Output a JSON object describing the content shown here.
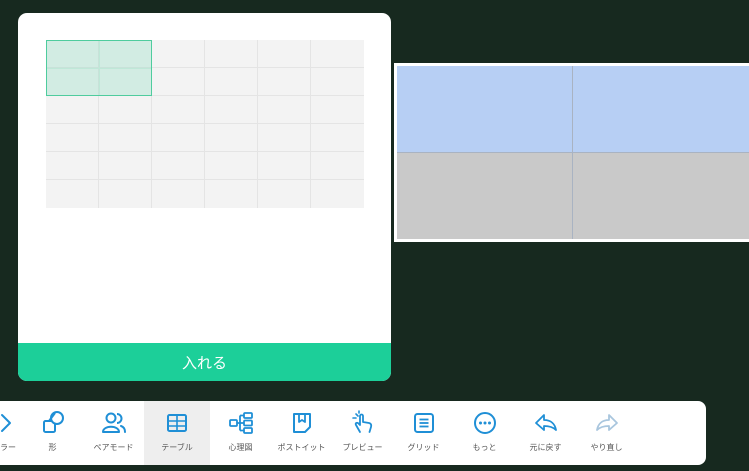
{
  "picker": {
    "rows": 6,
    "cols": 6,
    "selected_rows": 2,
    "selected_cols": 2,
    "insert_label": "入れる"
  },
  "canvas_table": {
    "rows": 2,
    "cols": 2,
    "row_colors": [
      "#b7cff4",
      "#c9c9c9"
    ]
  },
  "toolbar": {
    "accent": "#1f8fd6",
    "items": [
      {
        "id": "partial",
        "label": "ラー",
        "icon": "chevron-right-icon"
      },
      {
        "id": "shape",
        "label": "形",
        "icon": "shape-icon"
      },
      {
        "id": "pair",
        "label": "ペアモード",
        "icon": "pair-users-icon"
      },
      {
        "id": "table",
        "label": "テーブル",
        "icon": "table-icon",
        "active": true
      },
      {
        "id": "mindmap",
        "label": "心理図",
        "icon": "mindmap-icon"
      },
      {
        "id": "postit",
        "label": "ポストイット",
        "icon": "sticky-note-icon"
      },
      {
        "id": "preview",
        "label": "プレビュー",
        "icon": "hand-pointer-icon"
      },
      {
        "id": "grid",
        "label": "グリッド",
        "icon": "grid-list-icon"
      },
      {
        "id": "more",
        "label": "もっと",
        "icon": "more-dots-icon"
      },
      {
        "id": "undo",
        "label": "元に戻す",
        "icon": "undo-icon"
      },
      {
        "id": "redo",
        "label": "やり直し",
        "icon": "redo-icon"
      }
    ]
  }
}
